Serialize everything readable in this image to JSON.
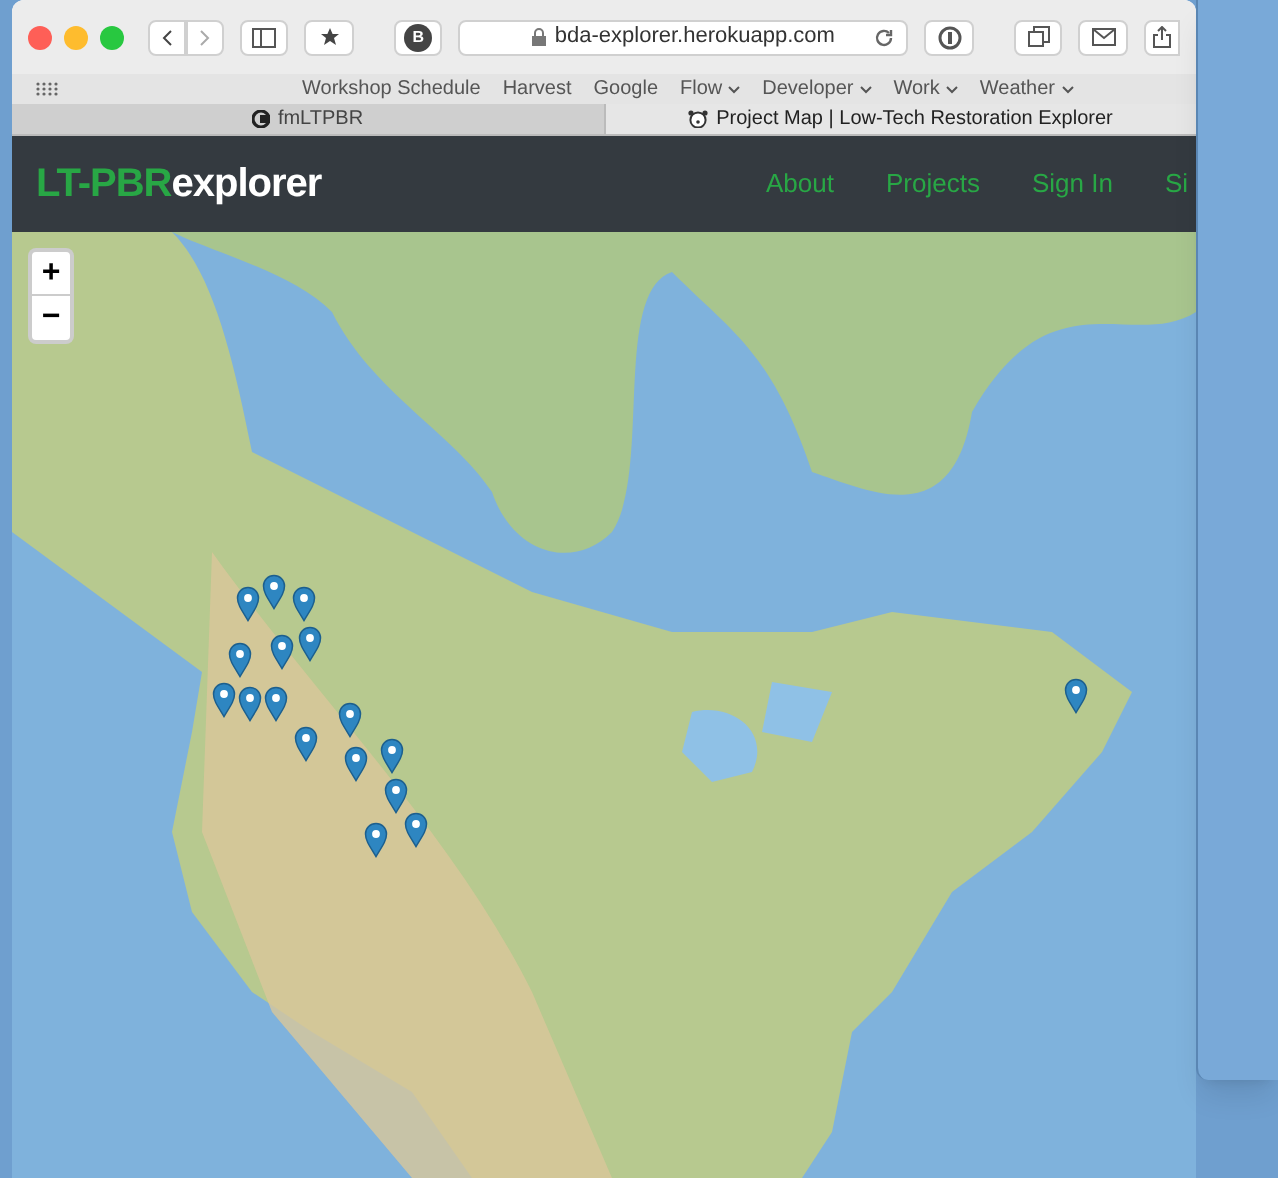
{
  "browser": {
    "url": "bda-explorer.herokuapp.com",
    "profile_badge": "B",
    "bookmarks": [
      {
        "label": "Workshop Schedule",
        "menu": false
      },
      {
        "label": "Harvest",
        "menu": false
      },
      {
        "label": "Google",
        "menu": false
      },
      {
        "label": "Flow",
        "menu": true
      },
      {
        "label": "Developer",
        "menu": true
      },
      {
        "label": "Work",
        "menu": true
      },
      {
        "label": "Weather",
        "menu": true
      }
    ],
    "tabs": [
      {
        "label": "fmLTPBR",
        "selected": false
      },
      {
        "label": "Project Map | Low-Tech Restoration Explorer",
        "selected": true
      }
    ]
  },
  "navbar": {
    "brand_accent": "LT-PBR",
    "brand_rest": "explorer",
    "links": [
      "About",
      "Projects",
      "Sign In",
      "Si"
    ]
  },
  "map": {
    "zoom_in": "+",
    "zoom_out": "−"
  }
}
